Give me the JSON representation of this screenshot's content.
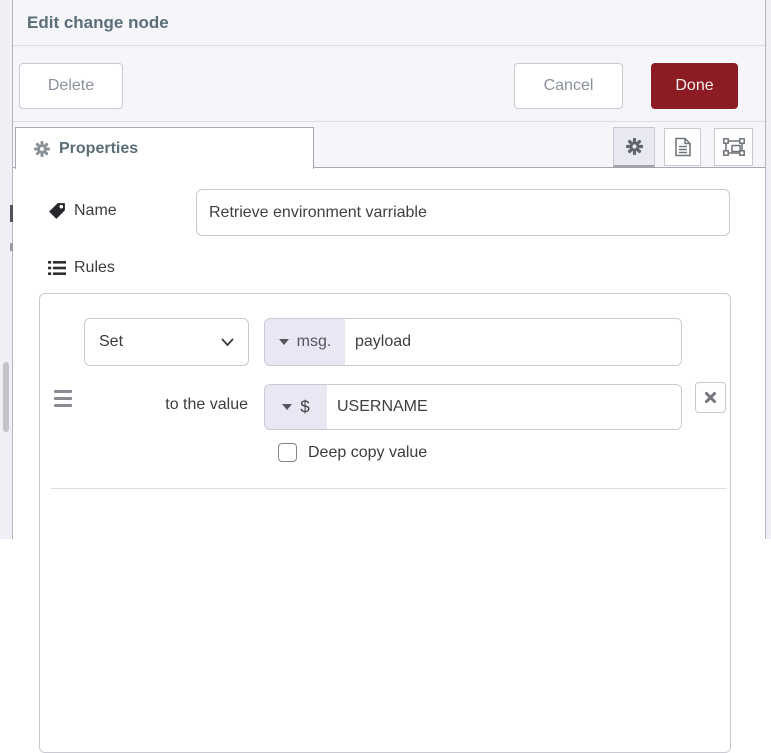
{
  "dialog": {
    "title": "Edit change node",
    "buttons": {
      "delete": "Delete",
      "cancel": "Cancel",
      "done": "Done"
    },
    "tabs": {
      "properties_label": "Properties"
    },
    "form": {
      "name": {
        "label": "Name",
        "value": "Retrieve environment varriable"
      },
      "rules": {
        "label": "Rules",
        "rule": {
          "action": "Set",
          "property_type": "msg.",
          "property": "payload",
          "to_label": "to the value",
          "value_type": "$",
          "value": "USERNAME",
          "deep_copy_label": "Deep copy value",
          "deep_copy_checked": false
        }
      }
    },
    "colors": {
      "done_red": "#8c1b23",
      "tray_background": "#f5f5fa",
      "type_prefix_background": "#e8e8f5",
      "header_text": "#5b6e78"
    },
    "icons": [
      "gear-icon",
      "document-icon",
      "appearance-icon",
      "tag-icon",
      "list-icon",
      "chevron-down-icon",
      "caret-down-icon",
      "drag-handle-icon",
      "remove-icon"
    ]
  }
}
